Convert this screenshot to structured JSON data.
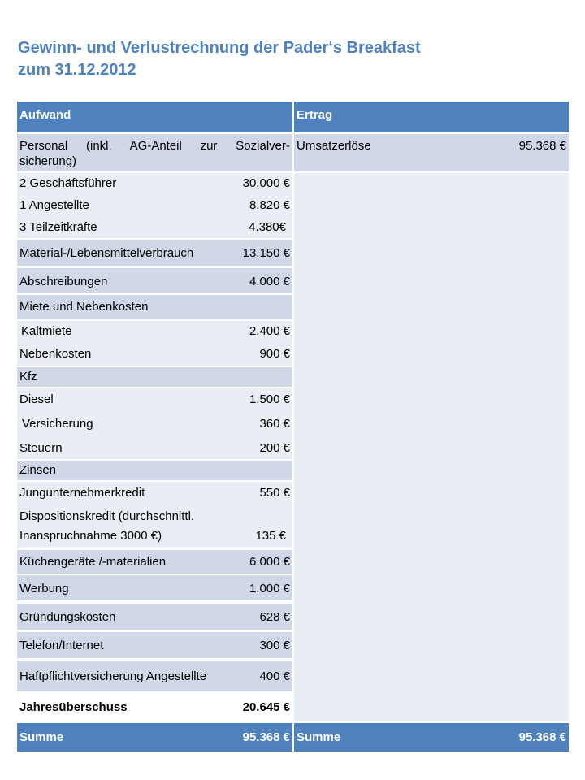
{
  "title": {
    "line1": "Gewinn- und Verlustrechnung der Paderʻs Breakfast",
    "line2": "zum 31.12.2012"
  },
  "aufwand": {
    "header": "Aufwand",
    "personal_label_1": "Personal (inkl. AG-Anteil zur Sozialver-",
    "personal_label_2": "sicherung)",
    "rows": [
      {
        "label": "2 Geschäftsführer",
        "value": "30.000 €"
      },
      {
        "label": "1 Angestellte",
        "value": "8.820 €"
      },
      {
        "label": "3 Teilzeitkräfte",
        "value": "4.380€"
      },
      {
        "label": "Material-/Lebensmittelverbrauch",
        "value": "13.150 €"
      },
      {
        "label": "Abschreibungen",
        "value": "4.000 €"
      },
      {
        "label": "Miete und Nebenkosten",
        "value": ""
      },
      {
        "label": "Kaltmiete",
        "value": "2.400 €"
      },
      {
        "label": "Nebenkosten",
        "value": "900 €"
      },
      {
        "label": "Kfz",
        "value": ""
      },
      {
        "label": "Diesel",
        "value": "1.500 €"
      },
      {
        "label": "Versicherung",
        "value": "360 €"
      },
      {
        "label": "Steuern",
        "value": "200 €"
      },
      {
        "label": "Zinsen",
        "value": ""
      },
      {
        "label": "Jungunternehmerkredit",
        "value": "550 €"
      },
      {
        "label": "Dispositionskredit (durchschnittl.",
        "value": ""
      },
      {
        "label": "Inanspruchnahme 3000 €)",
        "value": "135 €"
      },
      {
        "label": "Küchengeräte /-materialien",
        "value": "6.000 €"
      },
      {
        "label": "Werbung",
        "value": "1.000 €"
      },
      {
        "label": "Gründungskosten",
        "value": "628  €"
      },
      {
        "label": "Telefon/Internet",
        "value": "300 €"
      },
      {
        "label": "Haftpflichtversicherung Angestellte",
        "value": "400 €"
      },
      {
        "label": "Jahresüberschuss",
        "value": "20.645 €"
      }
    ],
    "summe_label": "Summe",
    "summe_value": "95.368 €"
  },
  "ertrag": {
    "header": "Ertrag",
    "umsatz_label": "Umsatzerlöse",
    "umsatz_value": "95.368 €",
    "summe_label": "Summe",
    "summe_value": "95.368 €"
  }
}
